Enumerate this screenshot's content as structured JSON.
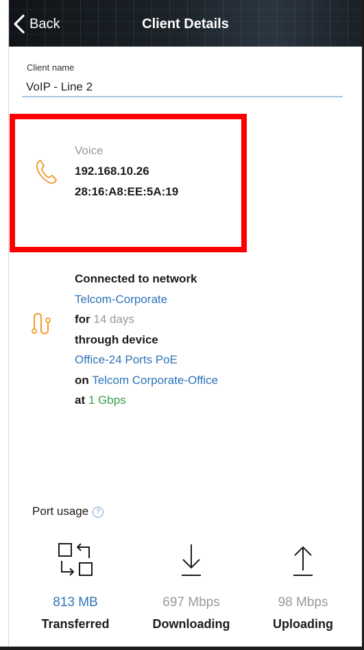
{
  "header": {
    "back_label": "Back",
    "title": "Client Details"
  },
  "client_name": {
    "label": "Client name",
    "value": "VoIP - Line 2"
  },
  "voice": {
    "type": "Voice",
    "ip": "192.168.10.26",
    "mac": "28:16:A8:EE:5A:19"
  },
  "network": {
    "connected_text": "Connected to network",
    "network_name": "Telcom-Corporate",
    "for_text": "for",
    "duration": "14 days",
    "through_text": "through device",
    "device_name": "Office-24 Ports PoE",
    "on_text": "on",
    "site_name": "Telcom Corporate-Office",
    "at_text": "at",
    "speed": "1 Gbps"
  },
  "port_usage": {
    "title": "Port usage",
    "stats": [
      {
        "value": "813 MB",
        "label": "Transferred",
        "icon": "swap-icon"
      },
      {
        "value": "697 Mbps",
        "label": "Downloading",
        "icon": "download-arrow-icon"
      },
      {
        "value": "98 Mbps",
        "label": "Uploading",
        "icon": "upload-arrow-icon"
      }
    ]
  },
  "colors": {
    "accent_blue": "#2d73b8",
    "accent_orange": "#f0a03c",
    "accent_green": "#3a9d4a",
    "highlight_red": "#ff0000"
  }
}
